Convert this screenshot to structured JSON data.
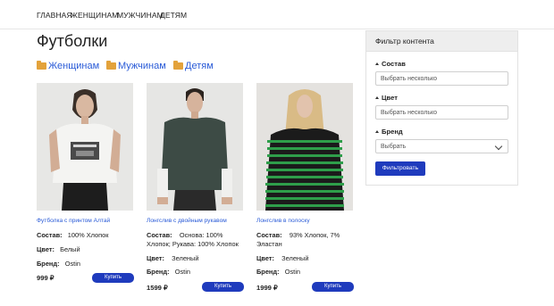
{
  "nav": [
    "ГЛАВНАЯ",
    "ЖЕНЩИНАМ",
    "МУЖЧИНАМ",
    "ДЕТЯМ"
  ],
  "page_title": "Футболки",
  "categories": [
    "Женщинам",
    "Мужчинам",
    "Детям"
  ],
  "labels": {
    "composition": "Состав:",
    "color": "Цвет:",
    "brand": "Бренд:"
  },
  "buy_label": "Купить",
  "products": [
    {
      "name": "Футболка с принтом Алтай",
      "composition": "100% Хлопок",
      "color": "Белый",
      "brand": "Ostin",
      "price": "999 ₽"
    },
    {
      "name": "Лонгслив с двойным рукавом",
      "composition": "Основа: 100% Хлопок; Рукава: 100% Хлопок",
      "color": "Зеленый",
      "brand": "Ostin",
      "price": "1599 ₽"
    },
    {
      "name": "Лонгслив в полоску",
      "composition": "93% Хлопок, 7% Эластан",
      "color": "Зеленый",
      "brand": "Ostin",
      "price": "1999 ₽"
    }
  ],
  "filter": {
    "title": "Фильтр контента",
    "composition_label": "Состав",
    "composition_placeholder": "Выбрать несколько",
    "color_label": "Цвет",
    "color_placeholder": "Выбрать несколько",
    "brand_label": "Бренд",
    "brand_value": "Выбрать",
    "submit": "Фильтровать"
  }
}
